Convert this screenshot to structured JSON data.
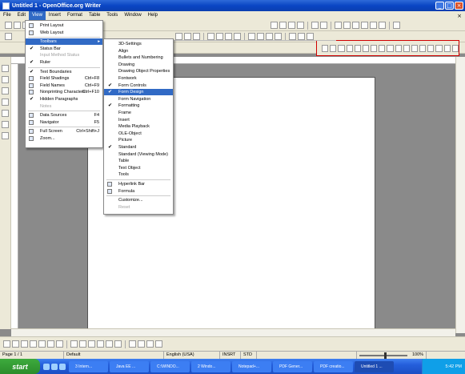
{
  "window": {
    "title": "Untitled 1 - OpenOffice.org Writer"
  },
  "menubar": [
    "File",
    "Edit",
    "View",
    "Insert",
    "Format",
    "Table",
    "Tools",
    "Window",
    "Help"
  ],
  "view_menu": {
    "items": [
      {
        "label": "Print Layout",
        "shortcut": "",
        "check": "",
        "icon": "print-layout-icon"
      },
      {
        "label": "Web Layout",
        "shortcut": "",
        "check": "",
        "icon": "web-layout-icon"
      },
      {
        "label": "Toolbars",
        "shortcut": "",
        "check": "",
        "submenu": true,
        "highlight": true
      },
      {
        "label": "Status Bar",
        "shortcut": "",
        "check": "✔"
      },
      {
        "label": "Input Method Status",
        "shortcut": "",
        "check": "",
        "disabled": true
      },
      {
        "label": "Ruler",
        "shortcut": "",
        "check": "✔"
      },
      {
        "label": "Text Boundaries",
        "shortcut": "",
        "check": "✔"
      },
      {
        "label": "Field Shadings",
        "shortcut": "Ctrl+F8",
        "check": "",
        "icon": "field-shadings-icon"
      },
      {
        "label": "Field Names",
        "shortcut": "Ctrl+F9",
        "check": "",
        "icon": "field-names-icon"
      },
      {
        "label": "Nonprinting Characters",
        "shortcut": "Ctrl+F10",
        "check": "",
        "icon": "nonprinting-icon"
      },
      {
        "label": "Hidden Paragraphs",
        "shortcut": "",
        "check": "✔"
      },
      {
        "label": "Notes",
        "shortcut": "",
        "check": "",
        "disabled": true
      },
      {
        "label": "Data Sources",
        "shortcut": "F4",
        "check": "",
        "icon": "data-sources-icon"
      },
      {
        "label": "Navigator",
        "shortcut": "F5",
        "check": "",
        "icon": "navigator-icon"
      },
      {
        "label": "Full Screen",
        "shortcut": "Ctrl+Shift+J",
        "check": "",
        "icon": "full-screen-icon"
      },
      {
        "label": "Zoom...",
        "shortcut": "",
        "check": "",
        "icon": "zoom-icon"
      }
    ]
  },
  "toolbars_menu": {
    "items": [
      {
        "label": "3D-Settings",
        "check": ""
      },
      {
        "label": "Align",
        "check": ""
      },
      {
        "label": "Bullets and Numbering",
        "check": ""
      },
      {
        "label": "Drawing",
        "check": ""
      },
      {
        "label": "Drawing Object Properties",
        "check": ""
      },
      {
        "label": "Fontwork",
        "check": ""
      },
      {
        "label": "Form Controls",
        "check": "✔"
      },
      {
        "label": "Form Design",
        "check": "✔",
        "highlight": true
      },
      {
        "label": "Form Navigation",
        "check": ""
      },
      {
        "label": "Formatting",
        "check": "✔"
      },
      {
        "label": "Frame",
        "check": ""
      },
      {
        "label": "Insert",
        "check": ""
      },
      {
        "label": "Media Playback",
        "check": ""
      },
      {
        "label": "OLE-Object",
        "check": ""
      },
      {
        "label": "Picture",
        "check": ""
      },
      {
        "label": "Standard",
        "check": "✔"
      },
      {
        "label": "Standard (Viewing Mode)",
        "check": ""
      },
      {
        "label": "Table",
        "check": ""
      },
      {
        "label": "Text Object",
        "check": ""
      },
      {
        "label": "Tools",
        "check": ""
      },
      {
        "label": "Hyperlink Bar",
        "check": "",
        "icon": "hyperlink-bar-icon"
      },
      {
        "label": "Formula",
        "check": "",
        "icon": "formula-icon"
      },
      {
        "label": "Customize...",
        "check": ""
      },
      {
        "label": "Reset",
        "check": "",
        "disabled": true
      }
    ]
  },
  "statusbar": {
    "page": "Page 1 / 1",
    "style": "Default",
    "language": "English (USA)",
    "insert_mode": "INSRT",
    "selection_mode": "STD",
    "zoom": "100%",
    "zoom_level": 0.55
  },
  "taskbar": {
    "start": "start",
    "tasks": [
      "3 Intern...",
      "Java EE ...",
      "C:\\WINDO...",
      "2 Windo...",
      "Notepad+...",
      "PDF Gener...",
      "PDF creatio...",
      "Untitled 1 ..."
    ],
    "clock": "5:42 PM"
  },
  "colors": {
    "accent": "#316ac5",
    "title_blue": "#0a46c4",
    "highlight_box": "#d00000",
    "taskbar": "#245edb",
    "start_green": "#3dab3d"
  }
}
